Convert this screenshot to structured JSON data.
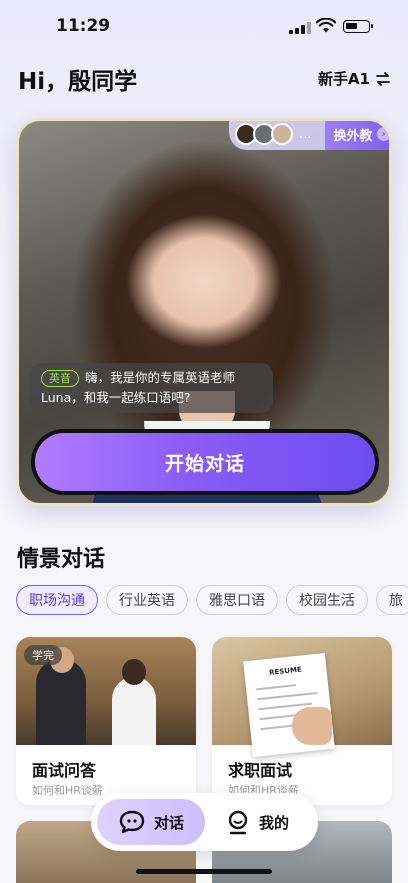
{
  "status_bar": {
    "time": "11:29"
  },
  "header": {
    "greeting": "Hi，殷同学",
    "level": "新手A1",
    "swap_icon": "swap-arrows-icon"
  },
  "hero": {
    "tutor_switch_label": "换外教",
    "tutor_more": "...",
    "accent_tag": "英音",
    "bubble_text": "嗨，我是你的专属英语老师Luna，和我一起练口语吧?",
    "start_button": "开始对话"
  },
  "scenes": {
    "title": "情景对话",
    "categories": [
      "职场沟通",
      "行业英语",
      "雅思口语",
      "校园生活",
      "旅"
    ],
    "cards": [
      {
        "title": "面试问答",
        "subtitle": "如何和HR谈薪",
        "badge": "学完"
      },
      {
        "title": "求职面试",
        "subtitle": "如何和HR谈薪",
        "image_text": "RESUME"
      }
    ]
  },
  "tabbar": {
    "tabs": [
      {
        "label": "对话",
        "icon": "chat-bubble-icon",
        "active": true
      },
      {
        "label": "我的",
        "icon": "profile-icon",
        "active": false
      }
    ]
  },
  "colors": {
    "accent": "#7c5cf0",
    "button_gradient_start": "#b07cff",
    "button_gradient_end": "#6d4cf0",
    "accent_tag": "#9ee34c"
  }
}
